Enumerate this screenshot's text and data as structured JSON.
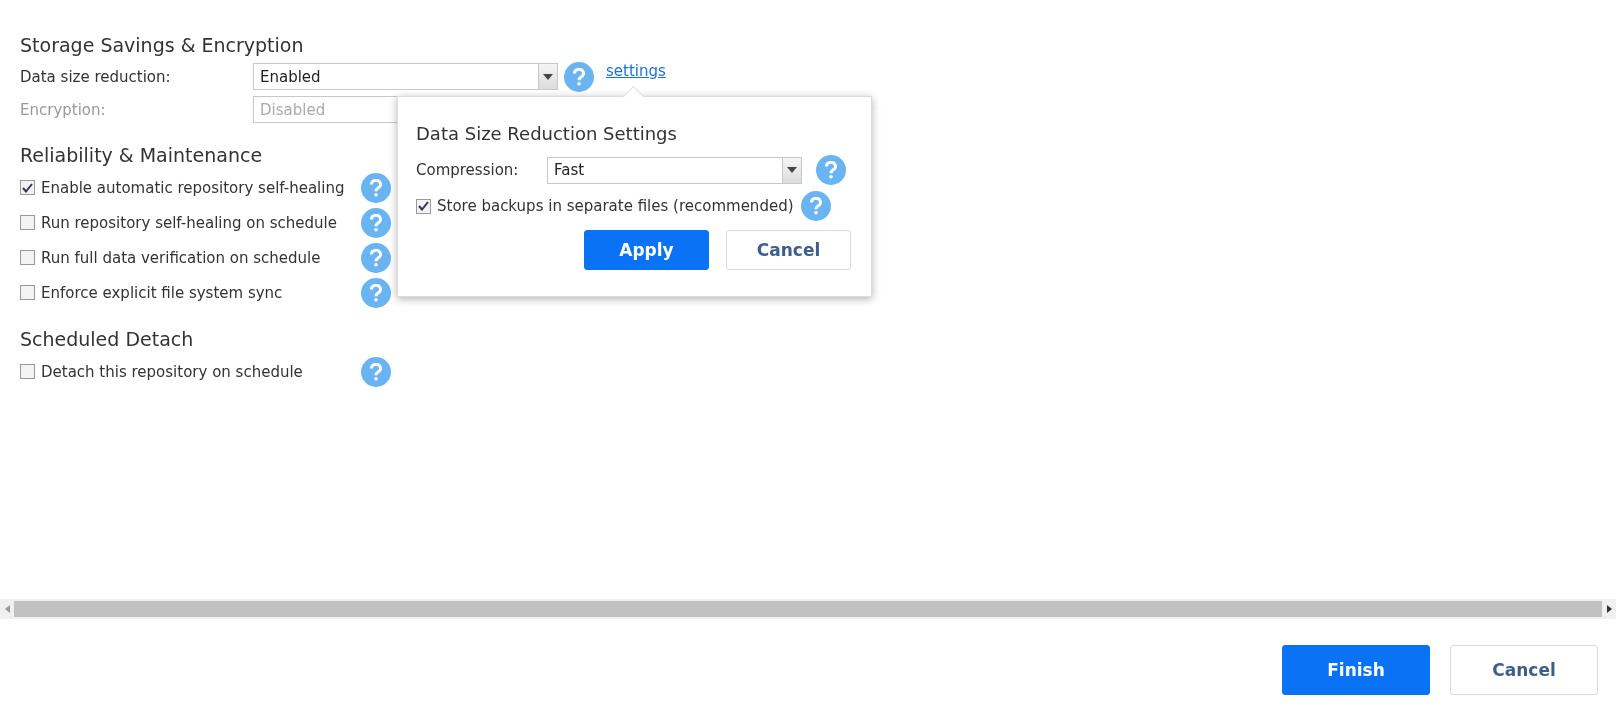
{
  "sections": [
    {
      "title": "Storage Savings & Encryption",
      "fields": [
        {
          "label": "Data size reduction:",
          "value": "Enabled",
          "disabled": false,
          "help": true,
          "link": "settings"
        },
        {
          "label": "Encryption:",
          "value": "Disabled",
          "disabled": true,
          "help": false
        }
      ]
    },
    {
      "title": "Reliability & Maintenance",
      "options": [
        {
          "label": "Enable automatic repository self-healing",
          "checked": true
        },
        {
          "label": "Run repository self-healing on schedule",
          "checked": false
        },
        {
          "label": "Run full data verification on schedule",
          "checked": false
        },
        {
          "label": "Enforce explicit file system sync",
          "checked": false
        }
      ]
    },
    {
      "title": "Scheduled Detach",
      "options": [
        {
          "label": "Detach this repository on schedule",
          "checked": false
        }
      ]
    }
  ],
  "popup": {
    "title": "Data Size Reduction Settings",
    "compression_label": "Compression:",
    "compression_value": "Fast",
    "option": {
      "label": "Store backups in separate files (recommended)",
      "checked": true
    },
    "buttons": [
      {
        "label": "Apply",
        "kind": "primary"
      },
      {
        "label": "Cancel",
        "kind": "secondary"
      }
    ]
  },
  "footer_buttons": [
    {
      "label": "Finish",
      "kind": "primary"
    },
    {
      "label": "Cancel",
      "kind": "secondary"
    }
  ]
}
